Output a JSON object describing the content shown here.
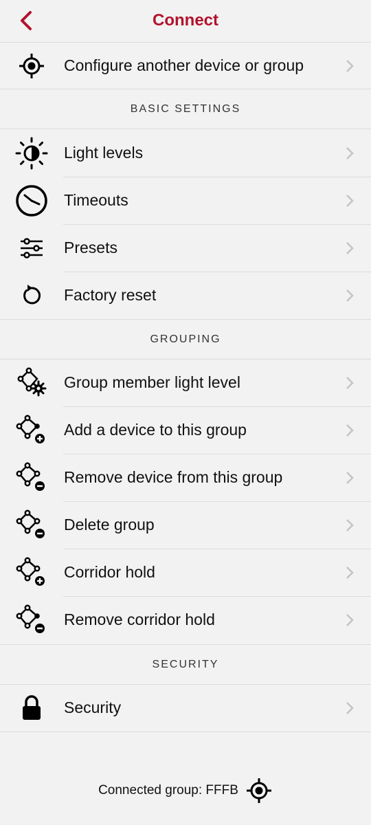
{
  "nav": {
    "title": "Connect",
    "back_icon": "chevron-left-icon"
  },
  "top_item": {
    "label": "Configure another device or group",
    "icon": "target-icon"
  },
  "sections": {
    "basic": {
      "header": "BASIC SETTINGS",
      "items": [
        {
          "label": "Light levels",
          "icon": "brightness-icon"
        },
        {
          "label": "Timeouts",
          "icon": "clock-icon"
        },
        {
          "label": "Presets",
          "icon": "sliders-icon"
        },
        {
          "label": "Factory reset",
          "icon": "reset-icon"
        }
      ]
    },
    "grouping": {
      "header": "GROUPING",
      "items": [
        {
          "label": "Group member light level",
          "icon": "group-gear-icon"
        },
        {
          "label": "Add a device to this group",
          "icon": "group-add-icon"
        },
        {
          "label": "Remove device from this group",
          "icon": "group-remove-icon"
        },
        {
          "label": "Delete group",
          "icon": "group-delete-icon"
        },
        {
          "label": "Corridor hold",
          "icon": "group-add-icon"
        },
        {
          "label": "Remove corridor hold",
          "icon": "group-remove-icon"
        }
      ]
    },
    "security": {
      "header": "SECURITY",
      "items": [
        {
          "label": "Security",
          "icon": "lock-icon"
        }
      ]
    }
  },
  "footer": {
    "text": "Connected group: FFFB",
    "icon": "target-icon"
  },
  "colors": {
    "accent": "#b3122d",
    "background": "#f2f2f2",
    "chevron": "#c4c4c4"
  }
}
